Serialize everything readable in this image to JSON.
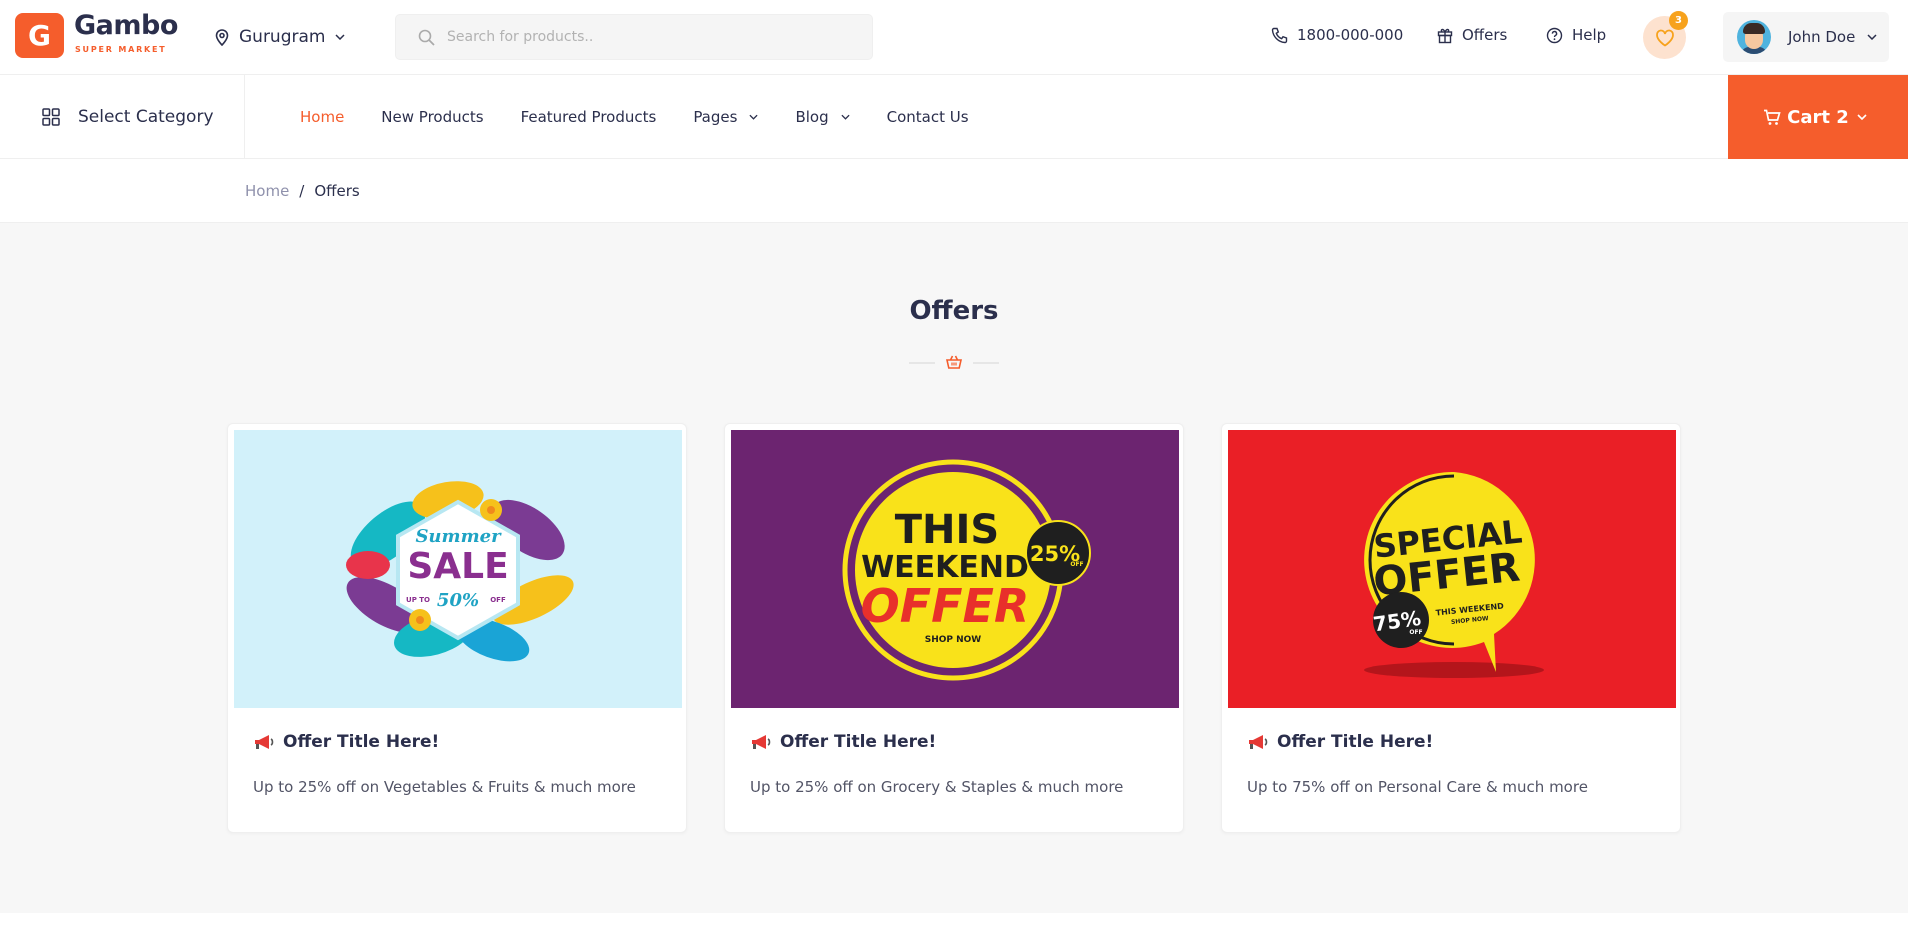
{
  "brand": {
    "letter": "G",
    "name": "Gambo",
    "tagline": "SUPER MARKET"
  },
  "location": {
    "city": "Gurugram"
  },
  "search": {
    "placeholder": "Search for products.."
  },
  "header_links": {
    "phone": "1800-000-000",
    "offers": "Offers",
    "help": "Help"
  },
  "wishlist": {
    "count": "3"
  },
  "user": {
    "name": "John Doe"
  },
  "category": {
    "label": "Select Category"
  },
  "menu": [
    {
      "label": "Home",
      "active": true
    },
    {
      "label": "New Products"
    },
    {
      "label": "Featured Products"
    },
    {
      "label": "Pages",
      "dropdown": true
    },
    {
      "label": "Blog",
      "dropdown": true
    },
    {
      "label": "Contact Us"
    }
  ],
  "cart": {
    "label": "Cart 2"
  },
  "breadcrumb": {
    "home": "Home",
    "separator": "/",
    "current": "Offers"
  },
  "section": {
    "title": "Offers"
  },
  "offers": [
    {
      "title": "Offer Title Here!",
      "description": "Up to 25% off on Vegetables & Fruits & much more",
      "banner": {
        "line1": "Summer",
        "line2": "SALE",
        "upto": "UP TO",
        "pct": "50%",
        "off": "OFF",
        "bg": "#d2f1fa"
      }
    },
    {
      "title": "Offer Title Here!",
      "description": "Up to 25% off on Grocery & Staples & much more",
      "banner": {
        "line1": "THIS",
        "line2": "WEEKEND",
        "line3": "OFFER",
        "shop": "SHOP NOW",
        "pct": "25%",
        "off": "OFF",
        "bg": "#6c2470"
      }
    },
    {
      "title": "Offer Title Here!",
      "description": "Up to 75% off on Personal Care & much more",
      "banner": {
        "line1": "SPECIAL",
        "line2": "OFFER",
        "sub1": "THIS WEEKEND",
        "sub2": "SHOP NOW",
        "pct": "75%",
        "off": "OFF",
        "bg": "#ea1f26"
      }
    }
  ],
  "colors": {
    "accent": "#f55d2c",
    "text": "#2b2f4c",
    "muted": "#8f91ac",
    "badge": "#f7a21c"
  }
}
